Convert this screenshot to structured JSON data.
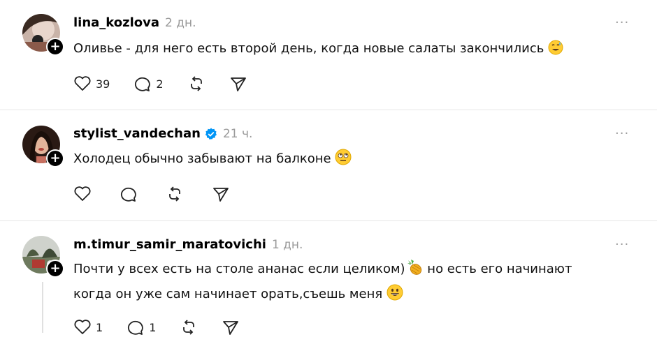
{
  "posts": [
    {
      "username": "lina_kozlova",
      "time": "2 дн.",
      "verified": false,
      "text": "Оливье - для него есть второй день, когда новые салаты закончились",
      "emoji": "grin-sweat",
      "likes": "39",
      "replies": "2",
      "reposts": "",
      "shares": ""
    },
    {
      "username": "stylist_vandechan",
      "time": "21 ч.",
      "verified": true,
      "text": "Холодец обычно забывают на балконе",
      "emoji": "eye-roll",
      "likes": "",
      "replies": "",
      "reposts": "",
      "shares": ""
    },
    {
      "username": "m.timur_samir_maratovichi",
      "time": "1 дн.",
      "verified": false,
      "text_line1": "Почти у всех есть на столе ананас если целиком)",
      "text_line1b": " но есть его начинают",
      "text_line2": "когда он уже сам начинает орать,съешь меня",
      "emoji": "pineapple",
      "emoji2": "grinning",
      "likes": "1",
      "replies": "1",
      "reposts": "",
      "shares": ""
    }
  ],
  "more_label": "···",
  "plus_label": "+",
  "colors": {
    "verified": "#0095f6",
    "muted": "#9a9a9a",
    "divider": "#e6e6e6"
  }
}
